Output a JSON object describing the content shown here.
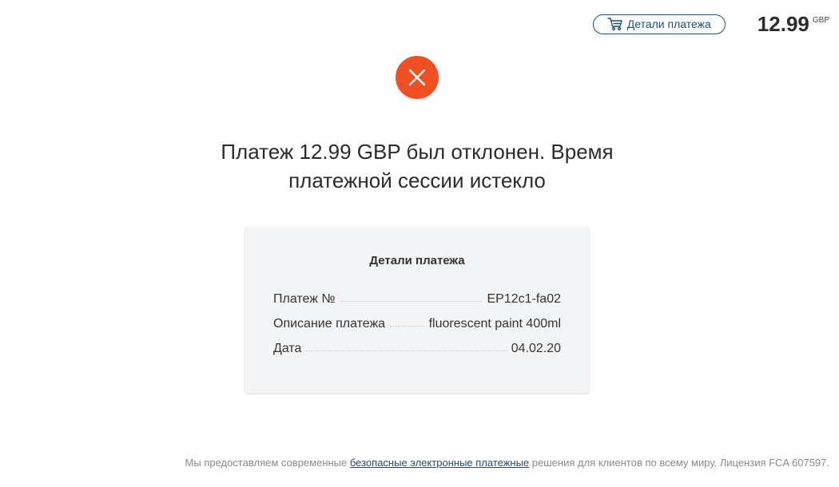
{
  "header": {
    "details_button_label": "Детали платежа",
    "amount": "12.99",
    "currency": "GBP"
  },
  "status": {
    "icon": "close-icon",
    "color": "#f04e23",
    "title_line1": "Платеж 12.99 GBP был отклонен. Время",
    "title_line2": "платежной сессии истекло"
  },
  "details": {
    "title": "Детали платежа",
    "rows": [
      {
        "label": "Платеж №",
        "value": "EP12c1-fa02"
      },
      {
        "label": "Описание платежа",
        "value": "fluorescent paint 400ml"
      },
      {
        "label": "Дата",
        "value": "04.02.20"
      }
    ]
  },
  "footer": {
    "text_before": "Мы предоставляем современные ",
    "link_text": "безопасные электронные платежные",
    "text_after": " решения для клиентов по всему миру. Лицензия FCA 607597."
  },
  "colors": {
    "accent": "#1f4e79",
    "error": "#f04e23",
    "card_bg": "#f3f4f6"
  }
}
